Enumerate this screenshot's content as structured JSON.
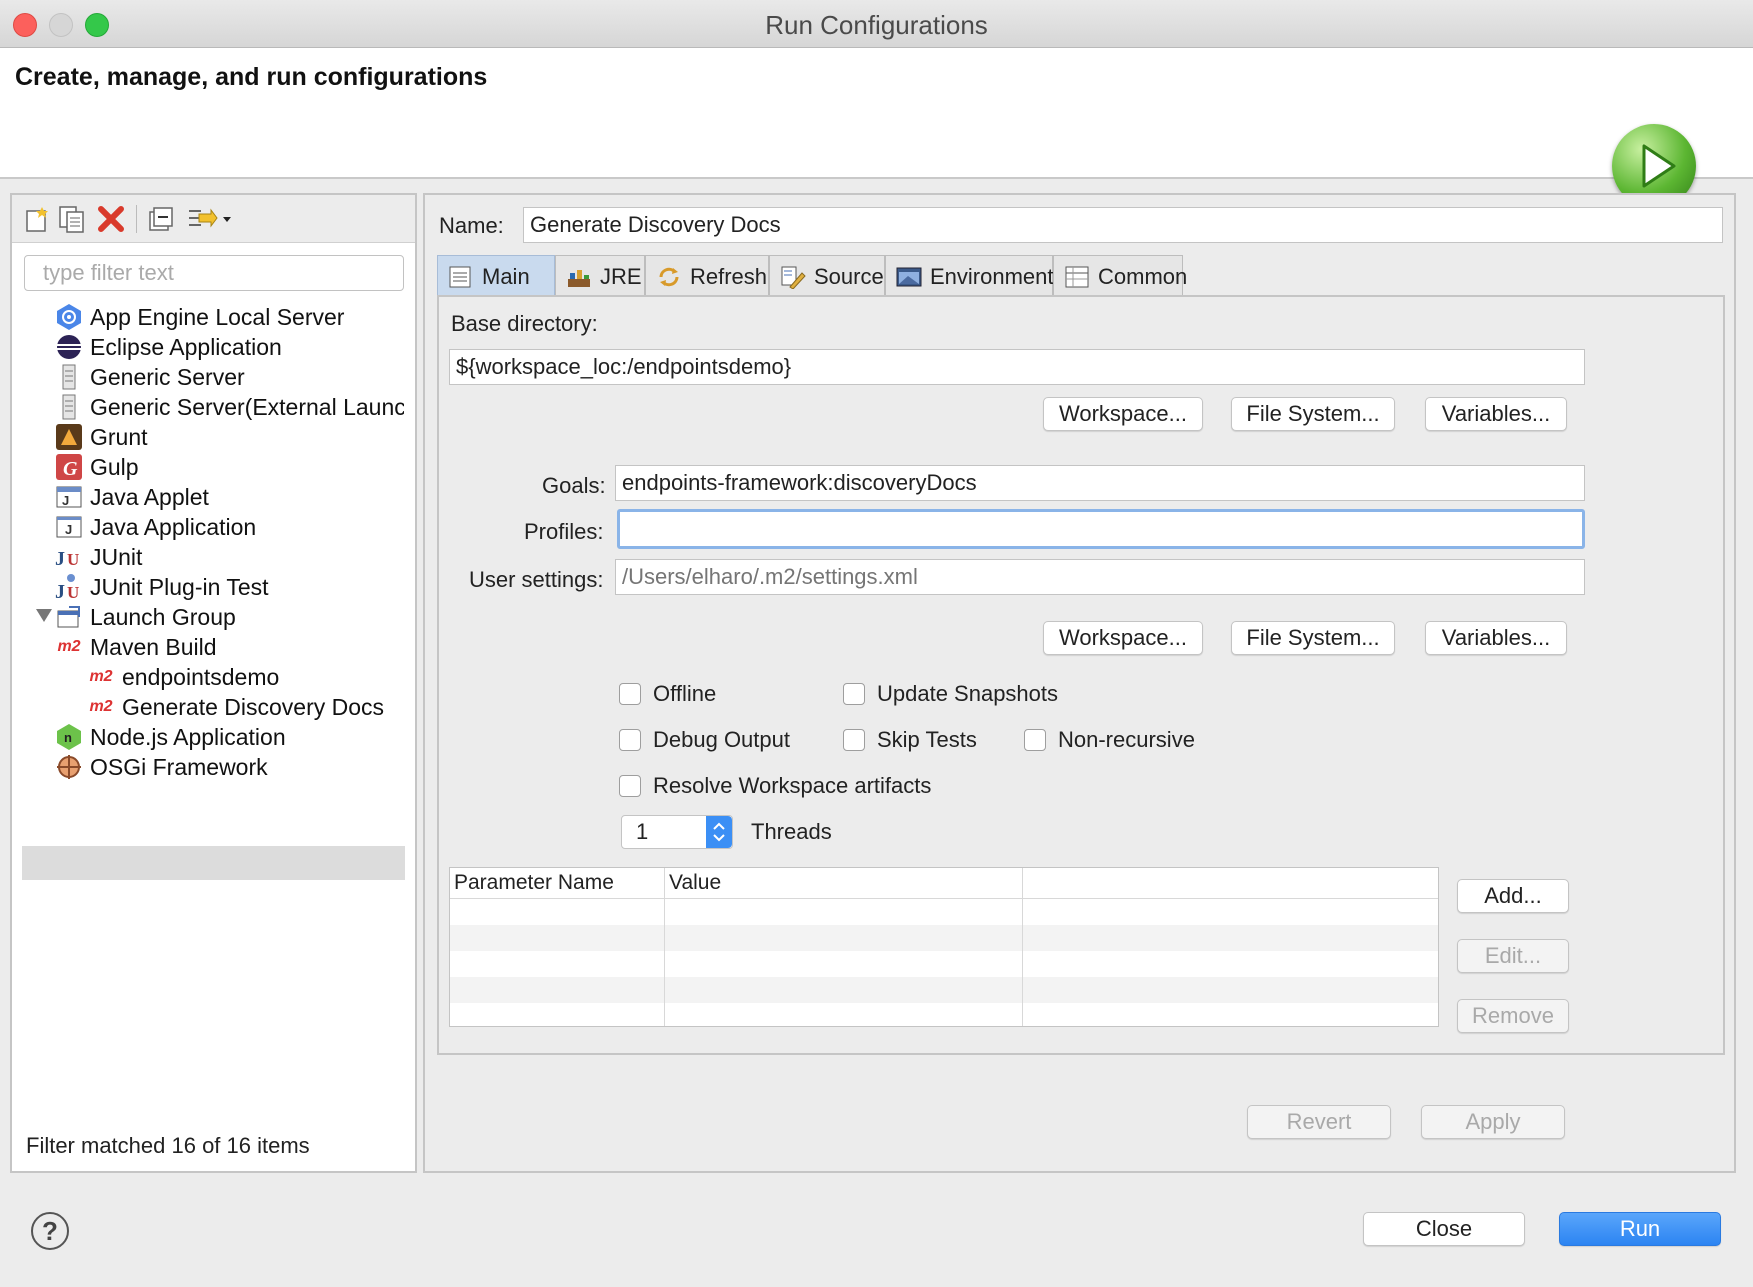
{
  "window": {
    "title": "Run Configurations"
  },
  "header": {
    "title": "Create, manage, and run configurations"
  },
  "left": {
    "filter_placeholder": "type filter text",
    "filter_status": "Filter matched 16 of 16 items",
    "tree": [
      {
        "label": "App Engine Local Server",
        "icon": "app-engine-icon"
      },
      {
        "label": "Eclipse Application",
        "icon": "eclipse-icon"
      },
      {
        "label": "Generic Server",
        "icon": "server-icon"
      },
      {
        "label": "Generic Server(External Launch)",
        "icon": "server-icon"
      },
      {
        "label": "Grunt",
        "icon": "grunt-icon"
      },
      {
        "label": "Gulp",
        "icon": "gulp-icon"
      },
      {
        "label": "Java Applet",
        "icon": "java-applet-icon"
      },
      {
        "label": "Java Application",
        "icon": "java-app-icon"
      },
      {
        "label": "JUnit",
        "icon": "junit-icon"
      },
      {
        "label": "JUnit Plug-in Test",
        "icon": "junit-plugin-icon"
      },
      {
        "label": "Launch Group",
        "icon": "launch-group-icon"
      },
      {
        "label": "Maven Build",
        "icon": "m2-icon",
        "expanded": true
      },
      {
        "label": "endpointsdemo",
        "icon": "m2-icon"
      },
      {
        "label": "Generate Discovery Docs",
        "icon": "m2-icon",
        "selected": true
      },
      {
        "label": "Node.js Application",
        "icon": "nodejs-icon"
      },
      {
        "label": "OSGi Framework",
        "icon": "osgi-icon"
      }
    ]
  },
  "config": {
    "name_label": "Name:",
    "name_value": "Generate Discovery Docs",
    "tabs": [
      {
        "label": "Main",
        "active": true
      },
      {
        "label": "JRE"
      },
      {
        "label": "Refresh"
      },
      {
        "label": "Source"
      },
      {
        "label": "Environment"
      },
      {
        "label": "Common"
      }
    ],
    "base_dir_label": "Base directory:",
    "base_dir_value": "${workspace_loc:/endpointsdemo}",
    "workspace_btn": "Workspace...",
    "filesystem_btn": "File System...",
    "variables_btn": "Variables...",
    "goals_label": "Goals:",
    "goals_value": "endpoints-framework:discoveryDocs",
    "profiles_label": "Profiles:",
    "profiles_value": "",
    "user_settings_label": "User settings:",
    "user_settings_placeholder": "/Users/elharo/.m2/settings.xml",
    "checkboxes": {
      "offline": "Offline",
      "update_snapshots": "Update Snapshots",
      "debug_output": "Debug Output",
      "skip_tests": "Skip Tests",
      "non_recursive": "Non-recursive",
      "resolve_workspace": "Resolve Workspace artifacts"
    },
    "threads_value": "1",
    "threads_label": "Threads",
    "param_headers": [
      "Parameter Name",
      "Value"
    ],
    "add_btn": "Add...",
    "edit_btn": "Edit...",
    "remove_btn": "Remove",
    "revert_btn": "Revert",
    "apply_btn": "Apply"
  },
  "footer": {
    "help": "?",
    "close_btn": "Close",
    "run_btn": "Run"
  },
  "colors": {
    "accent": "#2c84f2",
    "selection": "#dcdcdc",
    "tab_active": "#c9daee"
  }
}
